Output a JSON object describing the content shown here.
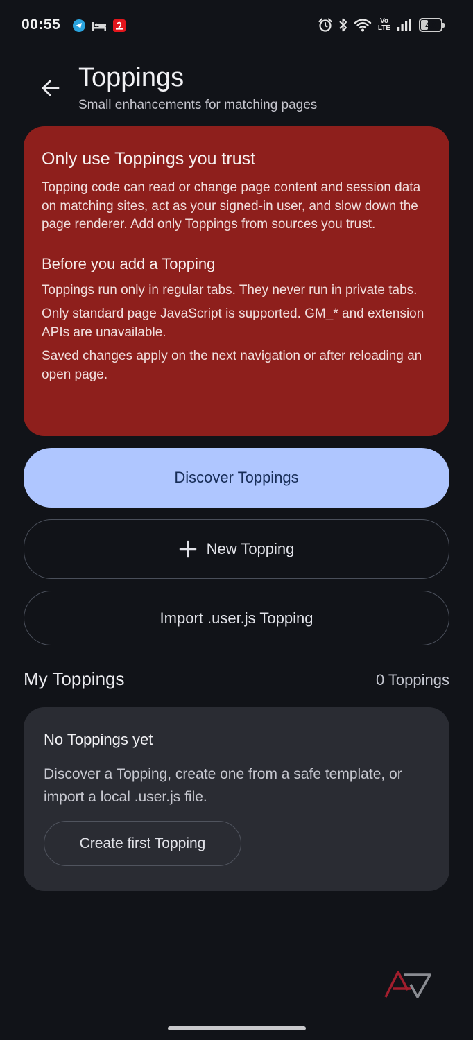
{
  "status_bar": {
    "time": "00:55",
    "left_icons": [
      "telegram-icon",
      "bed-icon",
      "airtel-icon"
    ],
    "right_icons": [
      "alarm-icon",
      "bluetooth-icon",
      "wifi-icon",
      "volte-icon",
      "signal-icon"
    ],
    "volte_label": "Vo LTE",
    "battery_percent": "40",
    "battery_level": 0.4
  },
  "header": {
    "title": "Toppings",
    "subtitle": "Small enhancements for matching pages"
  },
  "warning": {
    "title": "Only use Toppings you trust",
    "body": "Topping code can read or change page content and session data on matching sites, act as your signed-in user, and slow down the page renderer. Add only Toppings from sources you trust.",
    "subtitle": "Before you add a Topping",
    "items": [
      "Toppings run only in regular tabs. They never run in private tabs.",
      "Only standard page JavaScript is supported. GM_* and extension APIs are unavailable.",
      "Saved changes apply on the next navigation or after reloading an open page."
    ]
  },
  "actions": {
    "discover_label": "Discover Toppings",
    "new_label": "New Topping",
    "import_label": "Import .user.js Topping"
  },
  "my_toppings": {
    "title": "My Toppings",
    "count": "0 Toppings",
    "empty_title": "No Toppings yet",
    "empty_text": "Discover a Topping, create one from a safe template, or import a local .user.js file.",
    "create_label": "Create first Topping"
  },
  "colors": {
    "background": "#111318",
    "warning_bg": "#8e1f1c",
    "primary_button": "#afc6ff",
    "card_bg": "#2a2c33"
  }
}
